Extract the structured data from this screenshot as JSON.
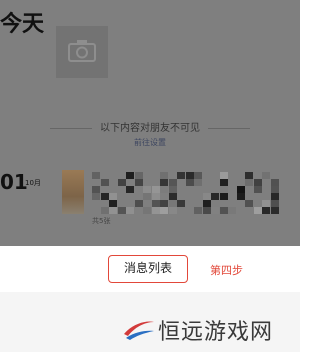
{
  "moments": {
    "today_label": "今天",
    "notice_text": "以下内容对朋友不可见",
    "notice_link": "前往设置",
    "post": {
      "day": "01",
      "month": "10月",
      "photo_count": "共5张"
    }
  },
  "annotation": {
    "button_label": "消息列表",
    "step_label": "第四步",
    "accent_color": "#e2483a"
  },
  "watermark": {
    "text": "恒远游戏网"
  },
  "icons": {
    "camera": "camera-icon",
    "logo": "swoosh-logo-icon"
  }
}
